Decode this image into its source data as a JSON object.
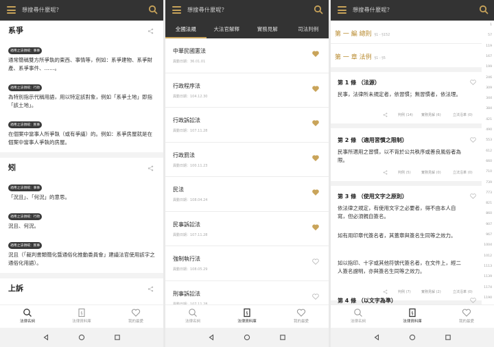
{
  "search_placeholder": "想搜尋什麼呢？",
  "bottom_nav": {
    "items": [
      {
        "label": "法律名詞",
        "icon": "search-icon"
      },
      {
        "label": "法律資料庫",
        "icon": "law-book-icon"
      },
      {
        "label": "我的最愛",
        "icon": "heart-icon"
      }
    ]
  },
  "screen1": {
    "terms": [
      {
        "title": "系爭",
        "defs": [
          {
            "tag": "適用之法領域：事事",
            "text": "通常簡稱雙方所爭執的東西、事情等，例如：系爭建物、系爭財產、系爭事件、……。"
          },
          {
            "tag": "適用之法領域：行政",
            "text": "為特別指示代稱用語，用以特定該對象，例如「系爭土地」即指「該土地」。"
          },
          {
            "tag": "適用之法領域：民事",
            "text": "在個案中當事人所爭執（或有爭議）的。例如：系爭房屋就是在個案中當事人爭執的房屋。"
          }
        ]
      },
      {
        "title": "矧",
        "defs": [
          {
            "tag": "適用之法領域：事事",
            "text": "「況且」、「何況」的意思。"
          },
          {
            "tag": "適用之法領域：行政",
            "text": "況且、何況。"
          },
          {
            "tag": "適用之法領域：民事",
            "text": "況且（「裁判書類簡化暨通俗化推動委員會」建議法官使用該字之通俗化用語）。"
          }
        ]
      },
      {
        "title": "上訴",
        "defs": []
      }
    ]
  },
  "screen2": {
    "tabs": [
      "全國法規",
      "大法官解釋",
      "實務見解",
      "司法判例"
    ],
    "active_tab": 0,
    "laws": [
      {
        "name": "中華民國憲法",
        "date": "異動日期：36.01.01",
        "favorite": true
      },
      {
        "name": "行政程序法",
        "date": "異動日期：104.12.30",
        "favorite": true
      },
      {
        "name": "行政訴訟法",
        "date": "異動日期：107.11.28",
        "favorite": true
      },
      {
        "name": "行政罰法",
        "date": "異動日期：100.11.23",
        "favorite": true
      },
      {
        "name": "民法",
        "date": "異動日期：108.04.24",
        "favorite": true
      },
      {
        "name": "民事訴訟法",
        "date": "異動日期：107.11.28",
        "favorite": true
      },
      {
        "name": "強制執行法",
        "date": "異動日期：108.05.29",
        "favorite": false
      },
      {
        "name": "刑事訴訟法",
        "date": "異動日期：107.11.28",
        "favorite": false
      }
    ]
  },
  "screen3": {
    "part": {
      "title": "第 一 編 總則",
      "range": "§1 - §152"
    },
    "chapter": {
      "title": "第 一 章 法例",
      "range": "§1 - §5"
    },
    "articles": [
      {
        "title": "第 1 條 （法源）",
        "paras": [
          "民事，法律所未規定者，依習慣；無習慣者，依法理。"
        ],
        "actions": [
          "判例 (14)",
          "實務見解 (6)",
          "立法沿革 (0)"
        ]
      },
      {
        "title": "第 2 條 （適用習慣之限制）",
        "paras": [
          "民事所適用之習慣，以不背於公共秩序或善良風俗者為限。"
        ],
        "actions": [
          "判例 (5)",
          "實務見解 (0)",
          "立法沿革 (0)"
        ]
      },
      {
        "title": "第 3 條 （使用文字之原則）",
        "paras": [
          "依法律之規定，有使用文字之必要者，得不由本人自寫，但必須親自簽名。",
          "如有用印章代簽名者，其蓋章與簽名生同等之效力。",
          "如以指印、十字或其他符號代簽名者，在文件上，經二人簽名證明，亦與簽名生同等之效力。"
        ],
        "actions": [
          "判例 (7)",
          "實務見解 (2)",
          "立法沿革 (0)"
        ]
      },
      {
        "title": "第 4 條 （以文字為準）",
        "paras": [],
        "actions": []
      }
    ],
    "index": [
      "1",
      "57",
      "119",
      "167",
      "199",
      "246",
      "309",
      "344",
      "384",
      "421",
      "490",
      "553",
      "612",
      "660",
      "710",
      "739",
      "773",
      "821",
      "860",
      "907",
      "967",
      "1004",
      "1012",
      "1113",
      "1139",
      "1174",
      "1190"
    ]
  },
  "colors": {
    "accent": "#c9a45a",
    "topbar": "#333333"
  }
}
